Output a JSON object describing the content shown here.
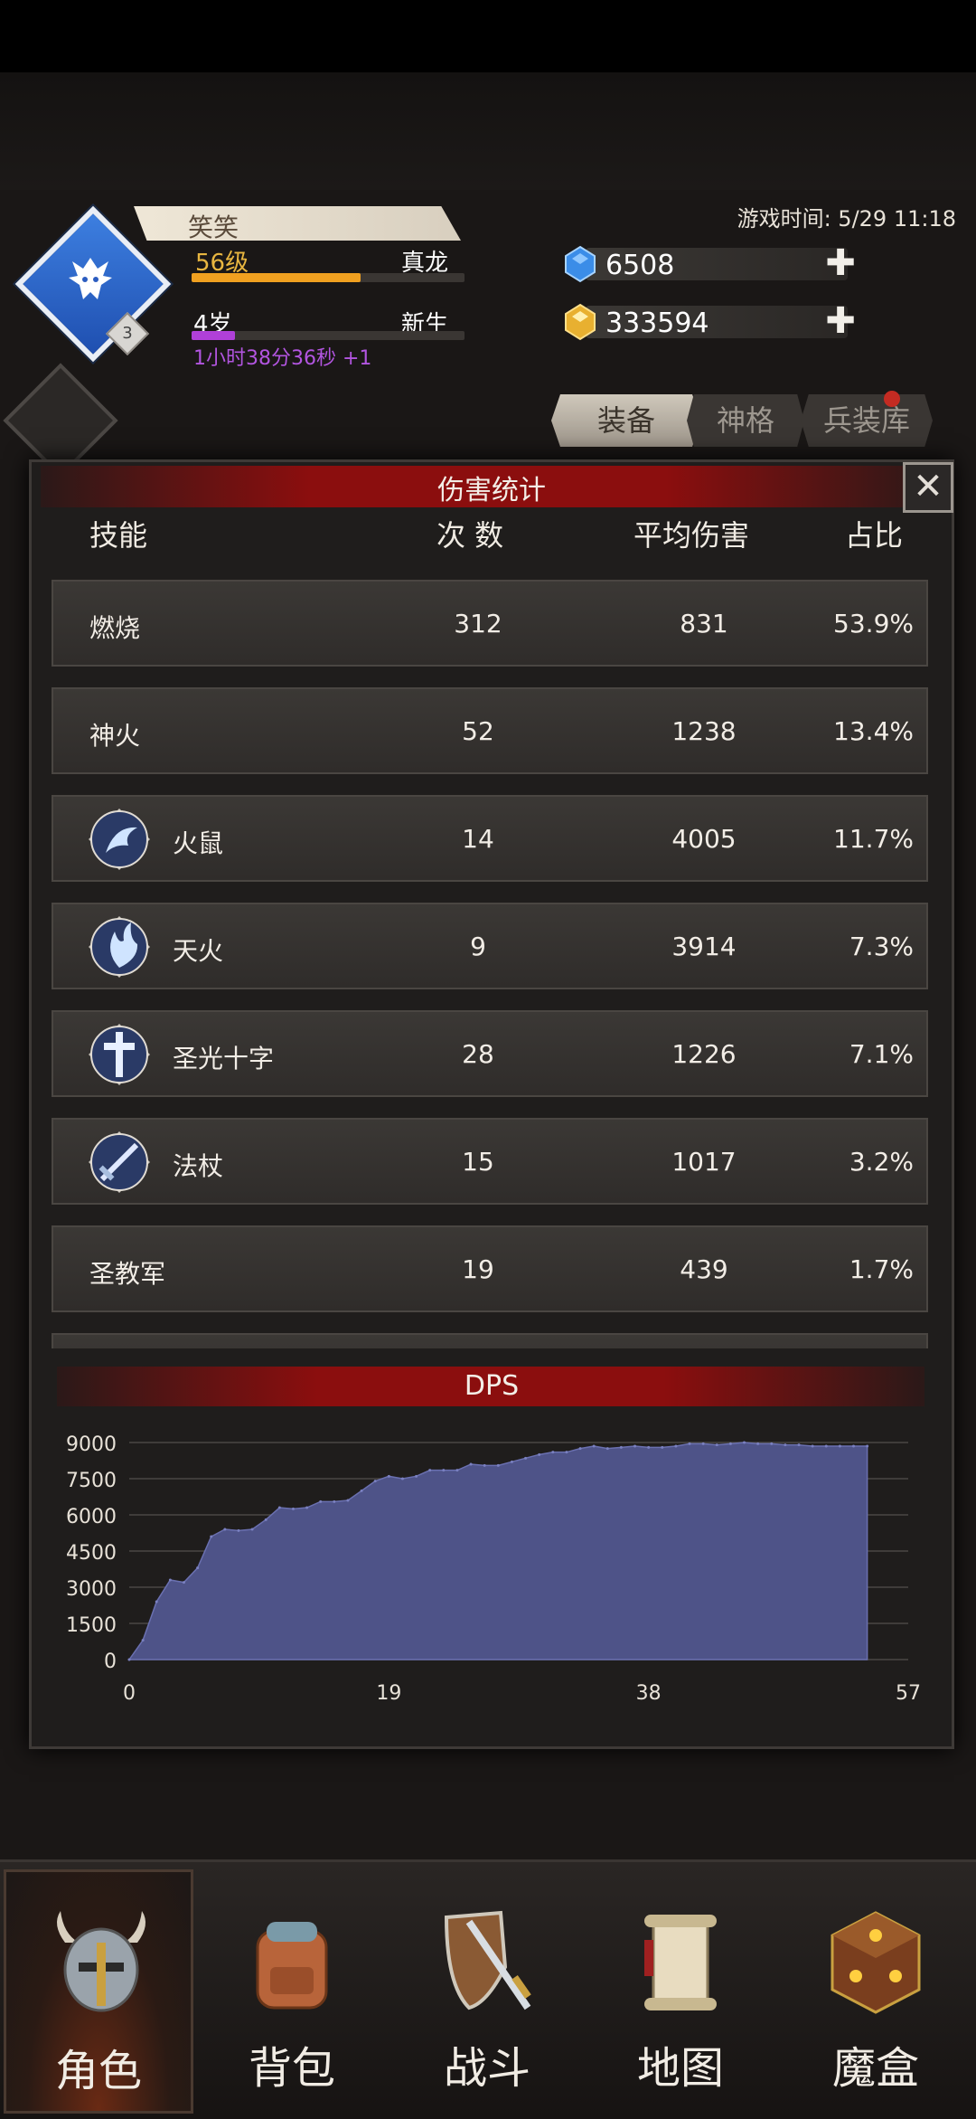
{
  "header": {
    "faded_title": "",
    "player_name": "笑笑",
    "level": "56级",
    "rank_title": "真龙",
    "level_progress": 0.62,
    "age": "4岁",
    "age_title": "新生",
    "age_progress": 0.16,
    "online_time": "1小时38分36秒 +1",
    "avatar_badge": "3",
    "game_time": "游戏时间: 5/29 11:18"
  },
  "currency": [
    {
      "icon": "blue-gem-icon",
      "value": "6508",
      "color": "#3b8de8"
    },
    {
      "icon": "gold-gem-icon",
      "value": "333594",
      "color": "#e8b030"
    }
  ],
  "tabs": [
    {
      "label": "装备",
      "active": true
    },
    {
      "label": "神格",
      "active": false
    },
    {
      "label": "兵装库",
      "active": false
    }
  ],
  "dialog": {
    "title": "伤害统计",
    "close_label": "✕",
    "columns": {
      "skill": "技能",
      "count": "次 数",
      "avg": "平均伤害",
      "share": "占比"
    },
    "rows": [
      {
        "name": "燃烧",
        "count": "312",
        "avg": "831",
        "share": "53.9%",
        "icon": ""
      },
      {
        "name": "神火",
        "count": "52",
        "avg": "1238",
        "share": "13.4%",
        "icon": ""
      },
      {
        "name": "火鼠",
        "count": "14",
        "avg": "4005",
        "share": "11.7%",
        "icon": "fire-rat-icon"
      },
      {
        "name": "天火",
        "count": "9",
        "avg": "3914",
        "share": "7.3%",
        "icon": "sky-fire-icon"
      },
      {
        "name": "圣光十字",
        "count": "28",
        "avg": "1226",
        "share": "7.1%",
        "icon": "holy-cross-icon"
      },
      {
        "name": "法杖",
        "count": "15",
        "avg": "1017",
        "share": "3.2%",
        "icon": "staff-sword-icon"
      },
      {
        "name": "圣教军",
        "count": "19",
        "avg": "439",
        "share": "1.7%",
        "icon": ""
      }
    ],
    "dps_title": "DPS"
  },
  "chart_data": {
    "type": "area",
    "title": "DPS",
    "xlabel": "",
    "ylabel": "",
    "xlim": [
      0,
      57
    ],
    "ylim": [
      0,
      9000
    ],
    "xticks": [
      0,
      19,
      38,
      57
    ],
    "yticks": [
      0,
      1500,
      3000,
      4500,
      6000,
      7500,
      9000
    ],
    "grid": true,
    "fill_color": "#4e5388",
    "x": [
      0,
      1,
      2,
      3,
      4,
      5,
      6,
      7,
      8,
      9,
      10,
      11,
      12,
      13,
      14,
      15,
      16,
      17,
      18,
      19,
      20,
      21,
      22,
      23,
      24,
      25,
      26,
      27,
      28,
      29,
      30,
      31,
      32,
      33,
      34,
      35,
      36,
      37,
      38,
      39,
      40,
      41,
      42,
      43,
      44,
      45,
      46,
      47,
      48,
      49,
      50,
      51,
      52,
      53,
      54
    ],
    "values": [
      0,
      800,
      2400,
      3300,
      3200,
      3800,
      5100,
      5400,
      5350,
      5400,
      5800,
      6300,
      6250,
      6300,
      6550,
      6550,
      6600,
      7000,
      7400,
      7600,
      7500,
      7600,
      7850,
      7850,
      7850,
      8100,
      8050,
      8050,
      8200,
      8350,
      8500,
      8600,
      8600,
      8750,
      8850,
      8750,
      8800,
      8850,
      8800,
      8800,
      8850,
      8950,
      8950,
      8900,
      8950,
      9000,
      8950,
      8950,
      8900,
      8900,
      8850,
      8850,
      8850,
      8850,
      8850
    ]
  },
  "nav": [
    {
      "label": "角色",
      "icon": "helmet-icon",
      "active": true
    },
    {
      "label": "背包",
      "icon": "backpack-icon",
      "active": false
    },
    {
      "label": "战斗",
      "icon": "sword-shield-icon",
      "active": false
    },
    {
      "label": "地图",
      "icon": "scroll-map-icon",
      "active": false
    },
    {
      "label": "魔盒",
      "icon": "magic-box-icon",
      "active": false
    }
  ]
}
